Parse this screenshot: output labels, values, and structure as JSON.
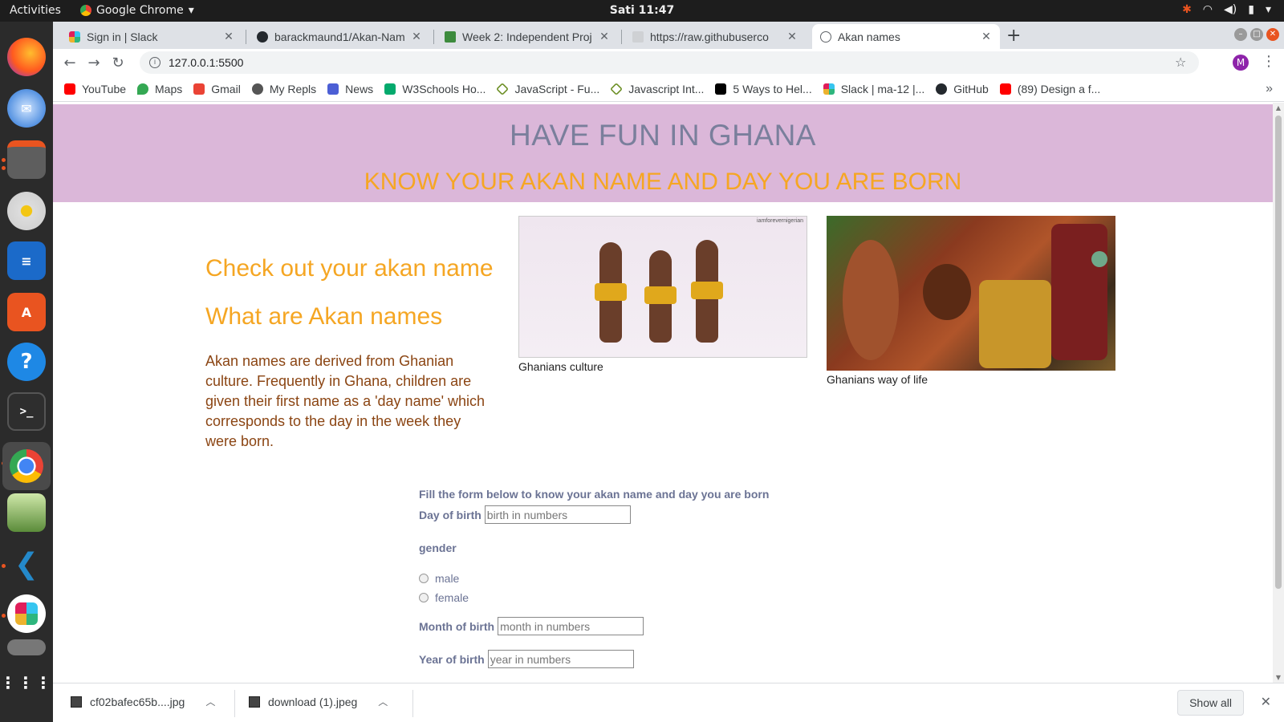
{
  "topbar": {
    "activities": "Activities",
    "app_name": "Google Chrome",
    "clock": "Sati 11:47"
  },
  "dock": {
    "items": [
      "firefox-icon",
      "thunderbird-icon",
      "files-icon",
      "rhythmbox-icon",
      "libreoffice-writer-icon",
      "software-center-icon",
      "help-icon",
      "terminal-icon",
      "chrome-icon",
      "image-viewer-icon",
      "vscode-icon",
      "slack-icon",
      "trash-icon",
      "show-apps-icon"
    ]
  },
  "tabs": [
    {
      "title": "Sign in | Slack",
      "icon": "slack-icon"
    },
    {
      "title": "barackmaund1/Akan-Nam",
      "icon": "github-icon"
    },
    {
      "title": "Week 2: Independent Proj",
      "icon": "moringa-icon"
    },
    {
      "title": "https://raw.githubuserco",
      "icon": "page-icon"
    },
    {
      "title": "Akan names",
      "icon": "globe-icon"
    }
  ],
  "address": {
    "url": "127.0.0.1:5500"
  },
  "profile": {
    "initial": "M",
    "color": "#8e24aa"
  },
  "bookmarks": [
    {
      "label": "YouTube",
      "color": "#ff0000"
    },
    {
      "label": "Maps",
      "color": "#34a853"
    },
    {
      "label": "Gmail",
      "color": "#ea4335"
    },
    {
      "label": "My Repls",
      "color": "#555555"
    },
    {
      "label": "News",
      "color": "#4c5fd5"
    },
    {
      "label": "W3Schools Ho...",
      "color": "#04aa6d"
    },
    {
      "label": "JavaScript - Fu...",
      "color": "#6b8e23"
    },
    {
      "label": "Javascript Int...",
      "color": "#6b8e23"
    },
    {
      "label": "5 Ways to Hel...",
      "color": "#000000"
    },
    {
      "label": "Slack | ma-12 |...",
      "color": "#e01e5a"
    },
    {
      "label": "GitHub",
      "color": "#24292e"
    },
    {
      "label": "(89) Design a f...",
      "color": "#ff0000"
    }
  ],
  "page": {
    "title": "HAVE FUN IN GHANA",
    "subtitle": "KNOW YOUR AKAN NAME AND DAY YOU ARE BORN",
    "check_heading": "Check out your akan name",
    "what_heading": "What are Akan names",
    "description": "Akan names are derived from Ghanian culture. Frequently in Ghana, children are given their first name as a 'day name' which corresponds to the day in the week they were born.",
    "image1_caption": "Ghanians culture",
    "image1_watermark": "iamforevernigerian",
    "image2_caption": "Ghanians way of life",
    "colors": {
      "banner": "#dbb7d9",
      "title": "#7a7f9c",
      "accent": "#f5a623",
      "body": "#8b4513"
    }
  },
  "form": {
    "lead": "Fill the form below to know your akan name and day you are born",
    "day_label": "Day of birth",
    "day_placeholder": "birth in numbers",
    "gender_label": "gender",
    "male_label": "male",
    "female_label": "female",
    "month_label": "Month of birth",
    "month_placeholder": "month in numbers",
    "year_label": "Year of birth",
    "year_placeholder": "year in numbers"
  },
  "downloads": [
    {
      "name": "cf02bafec65b....jpg"
    },
    {
      "name": "download (1).jpeg"
    }
  ],
  "downloads_show_all": "Show all"
}
